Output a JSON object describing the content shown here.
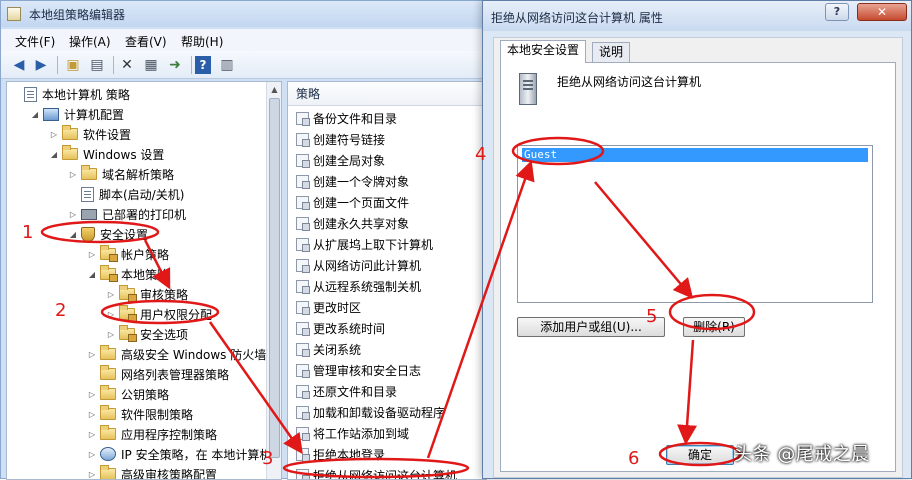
{
  "main_window": {
    "title": "本地组策略编辑器",
    "menu": [
      "文件(F)",
      "操作(A)",
      "查看(V)",
      "帮助(H)"
    ]
  },
  "toolbar_icons": [
    "back-arrow-icon",
    "forward-arrow-icon",
    "up-folder-icon",
    "show-hide-tree-icon",
    "delete-x-icon",
    "properties-icon",
    "export-icon",
    "help-icon",
    "view-icon"
  ],
  "tree": [
    {
      "label": "本地计算机 策略",
      "indent": 0,
      "toggle": "",
      "icon": "doc"
    },
    {
      "label": "计算机配置",
      "indent": 1,
      "toggle": "◢",
      "icon": "pc"
    },
    {
      "label": "软件设置",
      "indent": 2,
      "toggle": "▷",
      "icon": "folder"
    },
    {
      "label": "Windows 设置",
      "indent": 2,
      "toggle": "◢",
      "icon": "folder"
    },
    {
      "label": "域名解析策略",
      "indent": 3,
      "toggle": "▷",
      "icon": "folder"
    },
    {
      "label": "脚本(启动/关机)",
      "indent": 3,
      "toggle": "",
      "icon": "doc"
    },
    {
      "label": "已部署的打印机",
      "indent": 3,
      "toggle": "▷",
      "icon": "printer"
    },
    {
      "label": "安全设置",
      "indent": 3,
      "toggle": "◢",
      "icon": "shield"
    },
    {
      "label": "帐户策略",
      "indent": 4,
      "toggle": "▷",
      "icon": "lock-folder"
    },
    {
      "label": "本地策略",
      "indent": 4,
      "toggle": "◢",
      "icon": "lock-folder"
    },
    {
      "label": "审核策略",
      "indent": 5,
      "toggle": "▷",
      "icon": "lock-folder"
    },
    {
      "label": "用户权限分配",
      "indent": 5,
      "toggle": "▷",
      "icon": "lock-folder"
    },
    {
      "label": "安全选项",
      "indent": 5,
      "toggle": "▷",
      "icon": "lock-folder"
    },
    {
      "label": "高级安全 Windows 防火墙",
      "indent": 4,
      "toggle": "▷",
      "icon": "folder"
    },
    {
      "label": "网络列表管理器策略",
      "indent": 4,
      "toggle": "",
      "icon": "folder"
    },
    {
      "label": "公钥策略",
      "indent": 4,
      "toggle": "▷",
      "icon": "folder"
    },
    {
      "label": "软件限制策略",
      "indent": 4,
      "toggle": "▷",
      "icon": "folder"
    },
    {
      "label": "应用程序控制策略",
      "indent": 4,
      "toggle": "▷",
      "icon": "folder"
    },
    {
      "label": "IP 安全策略，在 本地计算机",
      "indent": 4,
      "toggle": "▷",
      "icon": "net"
    },
    {
      "label": "高级审核策略配置",
      "indent": 4,
      "toggle": "▷",
      "icon": "folder"
    }
  ],
  "policy_list": {
    "header": "策略",
    "items": [
      "备份文件和目录",
      "创建符号链接",
      "创建全局对象",
      "创建一个令牌对象",
      "创建一个页面文件",
      "创建永久共享对象",
      "从扩展坞上取下计算机",
      "从网络访问此计算机",
      "从远程系统强制关机",
      "更改时区",
      "更改系统时间",
      "关闭系统",
      "管理审核和安全日志",
      "还原文件和目录",
      "加载和卸载设备驱动程序",
      "将工作站添加到域",
      "拒绝本地登录",
      "拒绝从网络访问这台计算机"
    ]
  },
  "dialog": {
    "title": "拒绝从网络访问这台计算机 属性",
    "help_button": "?",
    "close_button": "✕",
    "tabs": [
      "本地安全设置",
      "说明"
    ],
    "heading": "拒绝从网络访问这台计算机",
    "list_items": [
      "Guest"
    ],
    "add_button": "添加用户或组(U)...",
    "remove_button": "删除(R)",
    "ok_button": "确定"
  },
  "annotations": {
    "steps": [
      "1",
      "2",
      "3",
      "4",
      "5",
      "6"
    ],
    "color": "#e01818"
  },
  "watermark": "头条 @尾戒之晨",
  "colors": {
    "selection": "#3399ff",
    "annotation_red": "#e01818"
  }
}
